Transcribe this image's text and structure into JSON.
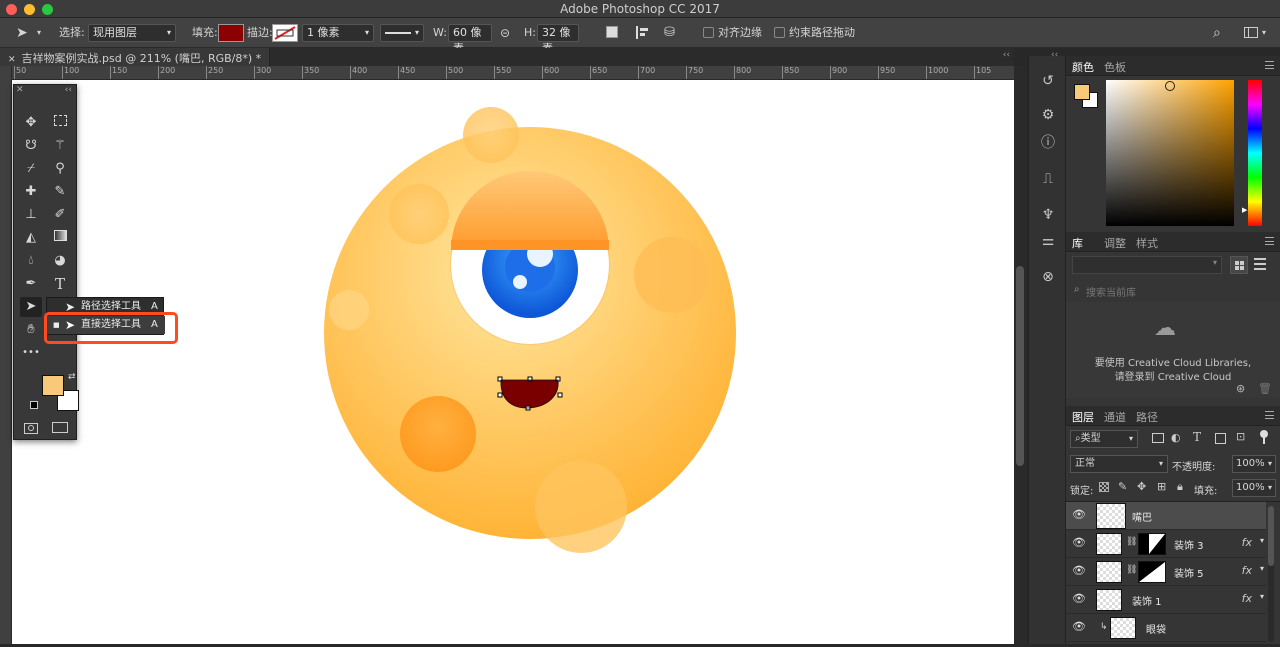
{
  "app": {
    "title": "Adobe Photoshop CC 2017"
  },
  "window_controls": {
    "close_color": "#ff5f57",
    "min_color": "#febc2e",
    "max_color": "#28c840"
  },
  "options_bar": {
    "select_label": "选择:",
    "select_value": "现用图层",
    "fill_label": "填充:",
    "fill_color": "#8b0000",
    "stroke_label": "描边:",
    "stroke_width": "1 像素",
    "w_label": "W:",
    "w_value": "60 像素",
    "h_label": "H:",
    "h_value": "32 像素",
    "align_edges": "对齐边缘",
    "constrain_path": "约束路径拖动"
  },
  "document_tab": {
    "label": "吉祥物案例实战.psd @ 211% (嘴巴, RGB/8*) *"
  },
  "ruler": {
    "marks": [
      "50",
      "100",
      "150",
      "200",
      "250",
      "300",
      "350",
      "400",
      "450",
      "500",
      "550",
      "600",
      "650",
      "700",
      "750",
      "800",
      "850",
      "900",
      "950",
      "1000",
      "105"
    ]
  },
  "toolbox": {
    "foreground_color": "#f9c97a",
    "background_color": "#ffffff",
    "more_label": "•••"
  },
  "flyout": {
    "items": [
      {
        "label": "路径选择工具",
        "shortcut": "A"
      },
      {
        "label": "直接选择工具",
        "shortcut": "A"
      }
    ]
  },
  "color_panel": {
    "tabs": [
      "颜色",
      "色板"
    ],
    "foreground": "#f9c97a",
    "hue_color": "#ffa200"
  },
  "library_panel": {
    "tabs": [
      "库",
      "调整",
      "样式"
    ],
    "search_placeholder": "搜索当前库",
    "message_line1": "要使用 Creative Cloud Libraries,",
    "message_line2": "请登录到 Creative Cloud"
  },
  "layers_panel": {
    "tabs": [
      "图层",
      "通道",
      "路径"
    ],
    "filter_kind": "类型",
    "blend_mode": "正常",
    "opacity_label": "不透明度:",
    "opacity_value": "100%",
    "lock_label": "锁定:",
    "fill_label": "填充:",
    "fill_value": "100%",
    "layers": [
      {
        "name": "嘴巴",
        "mask": false,
        "fx": false,
        "selected": true
      },
      {
        "name": "装饰 3",
        "mask": true,
        "fx": true,
        "selected": false
      },
      {
        "name": "装饰 5",
        "mask": true,
        "fx": true,
        "selected": false
      },
      {
        "name": "装饰 1",
        "mask": false,
        "fx": true,
        "selected": false
      },
      {
        "name": "眼袋",
        "mask": false,
        "fx": false,
        "selected": false
      }
    ],
    "fx_label": "fx"
  },
  "artwork": {
    "body_color": "#ffc04a",
    "mouth_color": "#7a0000",
    "iris_color": "#1e6fe6"
  }
}
